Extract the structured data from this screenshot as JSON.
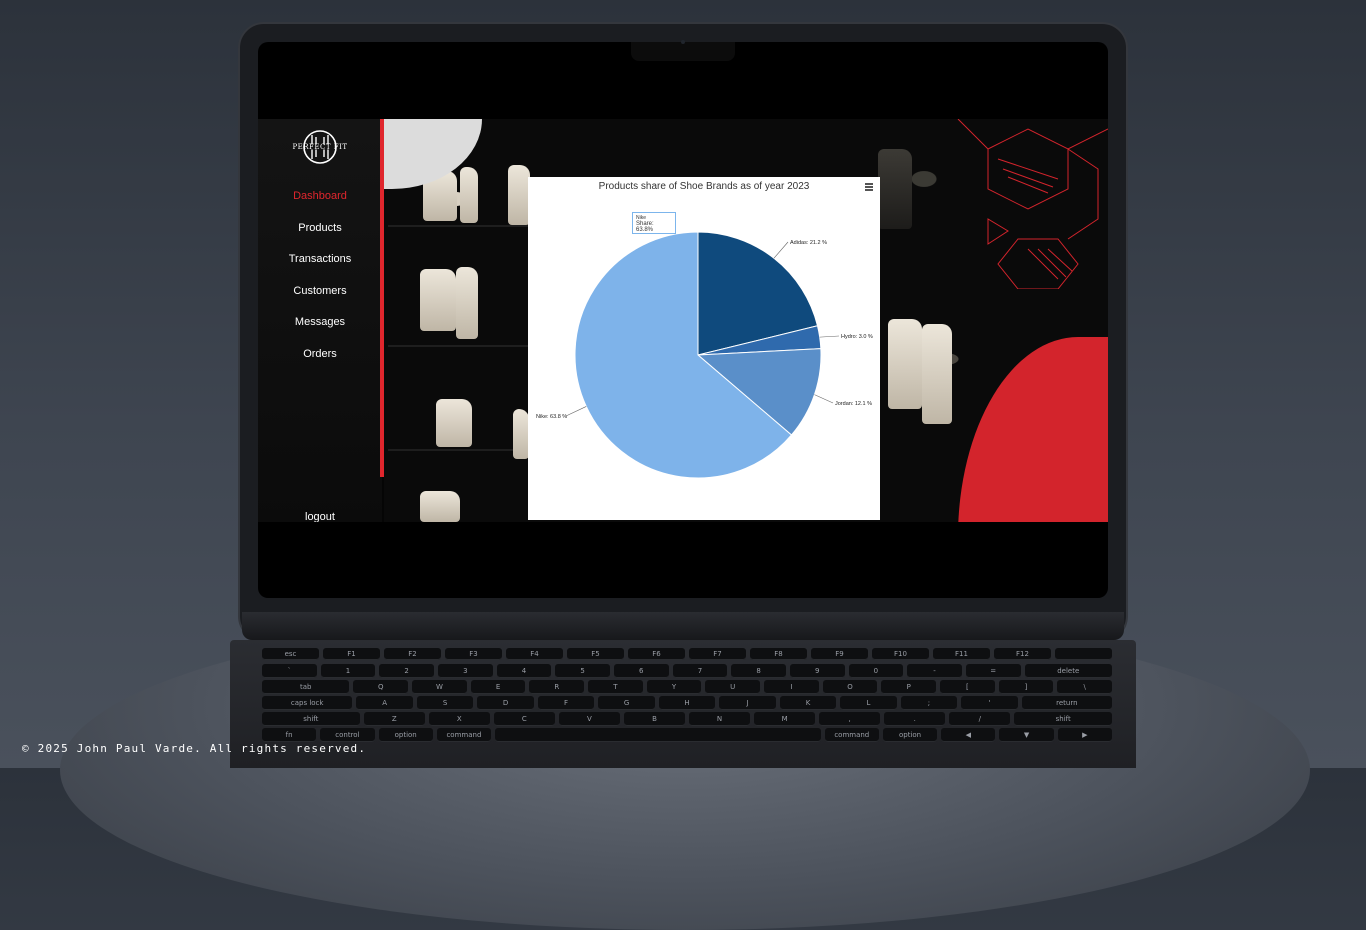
{
  "app": {
    "logo_text": "PERFECT FIT",
    "nav": [
      {
        "label": "Dashboard",
        "active": true
      },
      {
        "label": "Products",
        "active": false
      },
      {
        "label": "Transactions",
        "active": false
      },
      {
        "label": "Customers",
        "active": false
      },
      {
        "label": "Messages",
        "active": false
      },
      {
        "label": "Orders",
        "active": false
      }
    ],
    "logout_label": "logout",
    "accent_color": "#e0262d"
  },
  "chart_data": {
    "type": "pie",
    "title": "Products share of Shoe Brands as of year 2023",
    "slices": [
      {
        "name": "Adidas",
        "value": 21.2,
        "label": "Adidas: 21.2 %",
        "color": "#0f4a7d"
      },
      {
        "name": "Hydro",
        "value": 3.0,
        "label": "Hydro: 3.0 %",
        "color": "#2f6aad"
      },
      {
        "name": "Jordan",
        "value": 12.1,
        "label": "Jordan: 12.1 %",
        "color": "#5a8fc9"
      },
      {
        "name": "Nike",
        "value": 63.8,
        "label": "Nike: 63.8 %",
        "color": "#7eb3ea"
      }
    ],
    "tooltip": {
      "series": "Nike",
      "text": "Share: 63.8%"
    }
  },
  "footer": {
    "text": "© 2025 John Paul Varde. All rights reserved."
  },
  "keyboard": {
    "rows": [
      [
        "esc",
        "F1",
        "F2",
        "F3",
        "F4",
        "F5",
        "F6",
        "F7",
        "F8",
        "F9",
        "F10",
        "F11",
        "F12",
        ""
      ],
      [
        "`",
        "1",
        "2",
        "3",
        "4",
        "5",
        "6",
        "7",
        "8",
        "9",
        "0",
        "-",
        "=",
        "delete"
      ],
      [
        "tab",
        "Q",
        "W",
        "E",
        "R",
        "T",
        "Y",
        "U",
        "I",
        "O",
        "P",
        "[",
        "]",
        "\\"
      ],
      [
        "caps lock",
        "A",
        "S",
        "D",
        "F",
        "G",
        "H",
        "J",
        "K",
        "L",
        ";",
        "'",
        "return"
      ],
      [
        "shift",
        "Z",
        "X",
        "C",
        "V",
        "B",
        "N",
        "M",
        ",",
        ".",
        "/",
        "shift"
      ],
      [
        "fn",
        "control",
        "option",
        "command",
        "",
        "command",
        "option",
        "◀",
        "▼",
        "▶"
      ]
    ]
  }
}
